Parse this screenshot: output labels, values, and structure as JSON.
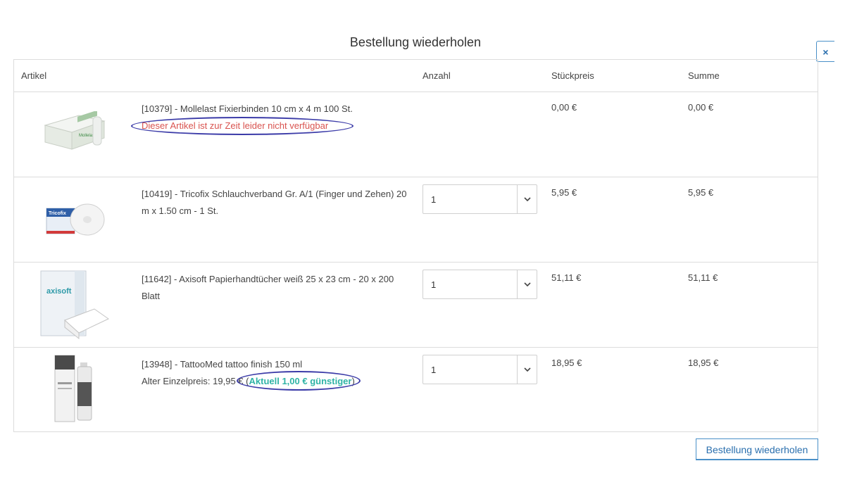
{
  "modal": {
    "title": "Bestellung wiederholen",
    "close_label": "×"
  },
  "table": {
    "columns": {
      "article": "Artikel",
      "quantity": "Anzahl",
      "unit_price": "Stückpreis",
      "total": "Summe"
    },
    "rows": [
      {
        "name": "[10379] - Mollelast Fixierbinden 10 cm x 4 m 100 St.",
        "notice": "Dieser Artikel ist zur Zeit leider nicht verfügbar",
        "unit_price": "0,00 €",
        "total": "0,00 €"
      },
      {
        "name": "[10419] - Tricofix Schlauchverband Gr. A/1 (Finger und Zehen) 20 m x 1.50 cm - 1 St.",
        "quantity": "1",
        "unit_price": "5,95 €",
        "total": "5,95 €"
      },
      {
        "name": "[11642] - Axisoft Papierhandtücher weiß 25 x 23 cm - 20 x 200 Blatt",
        "quantity": "1",
        "unit_price": "51,11 €",
        "total": "51,11 €"
      },
      {
        "name": "[13948] - TattooMed tattoo finish 150 ml",
        "old_price_label": "Alter Einzelpreis: 19,95 €",
        "savings_open": "(",
        "savings_text": "Aktuell 1,00 € günstiger",
        "savings_close": ")",
        "quantity": "1",
        "unit_price": "18,95 €",
        "total": "18,95 €"
      }
    ]
  },
  "actions": {
    "repeat_order_label": "Bestellung wiederholen"
  },
  "product_labels": {
    "mollelast": "Mollelast",
    "tricofix": "Tricofix",
    "axisoft": "axisoft"
  },
  "colors": {
    "accent": "#2a6fae",
    "unavailable": "#d9534f",
    "savings": "#2fb3a6",
    "annotation": "#3b3ba8"
  }
}
